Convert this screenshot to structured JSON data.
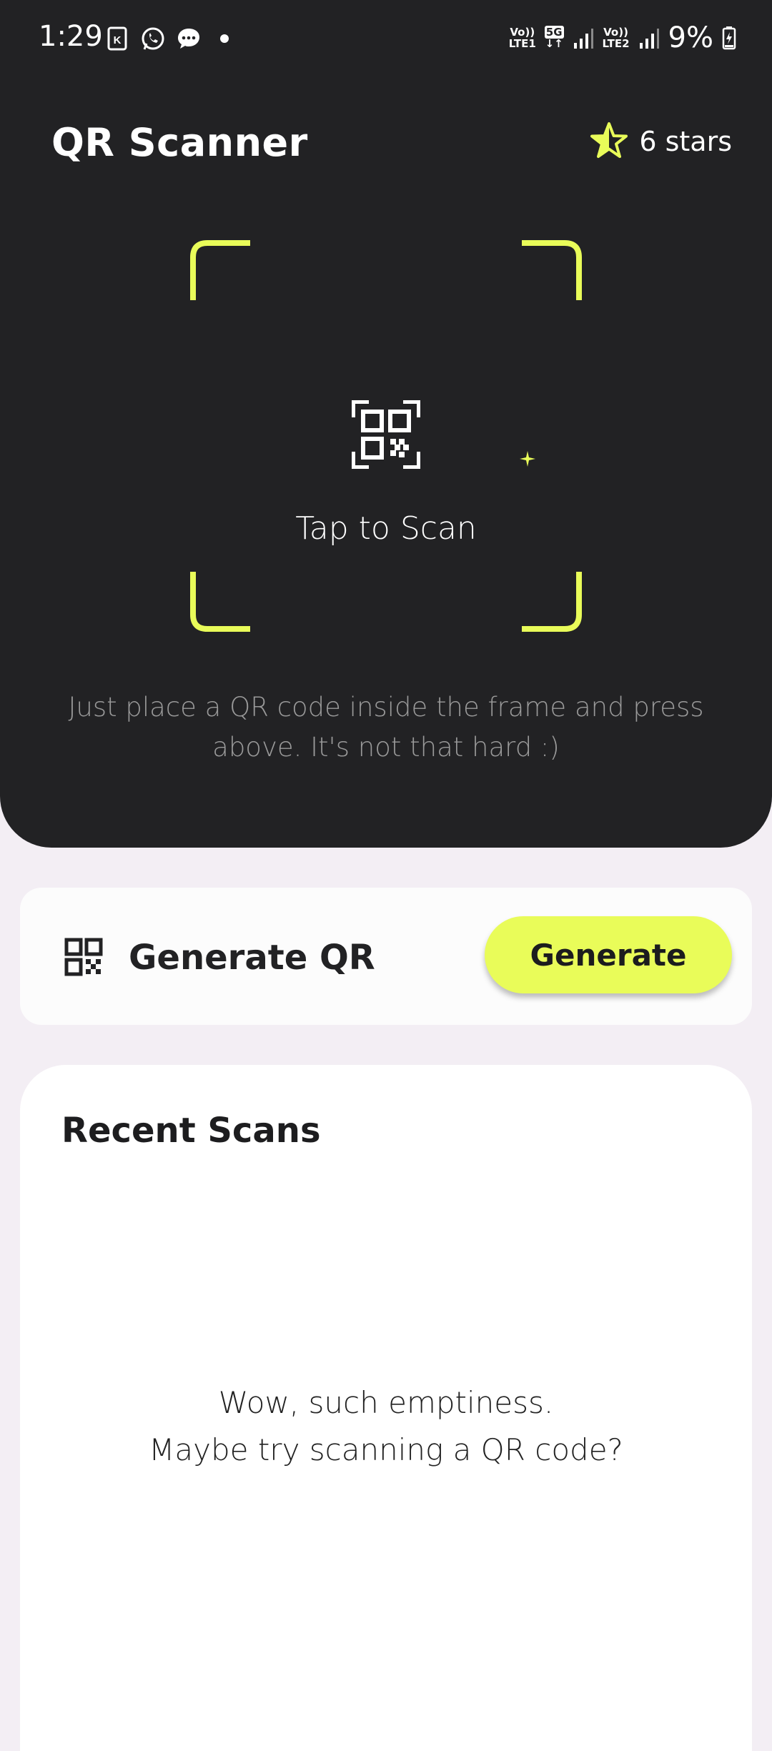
{
  "status_bar": {
    "time": "1:29",
    "battery_percent": "9%",
    "sim1_label_top": "Vo))",
    "sim1_label_bottom": "LTE1",
    "network_5g": "5G",
    "sim2_label_top": "Vo))",
    "sim2_label_bottom": "LTE2",
    "left_icons": [
      "k-app-icon",
      "whatsapp-icon",
      "message-icon",
      "notification-dot-icon"
    ]
  },
  "header": {
    "title": "QR Scanner",
    "stars_label": "6 stars",
    "star_icon": "star-icon"
  },
  "scanner": {
    "tap_label": "Tap to Scan",
    "hint": "Just place a QR code inside the frame and press above. It's not that hard :)",
    "icon": "qr-scan-icon",
    "accent_color": "#e9fc59"
  },
  "generate": {
    "title": "Generate QR",
    "button_label": "Generate",
    "icon": "qr-code-icon"
  },
  "recent": {
    "title": "Recent Scans",
    "empty_line1": "Wow, such emptiness.",
    "empty_line2": "Maybe try scanning a QR code?"
  },
  "colors": {
    "panel_bg": "#222224",
    "page_bg": "#f3eef4",
    "accent": "#e9fc59"
  }
}
